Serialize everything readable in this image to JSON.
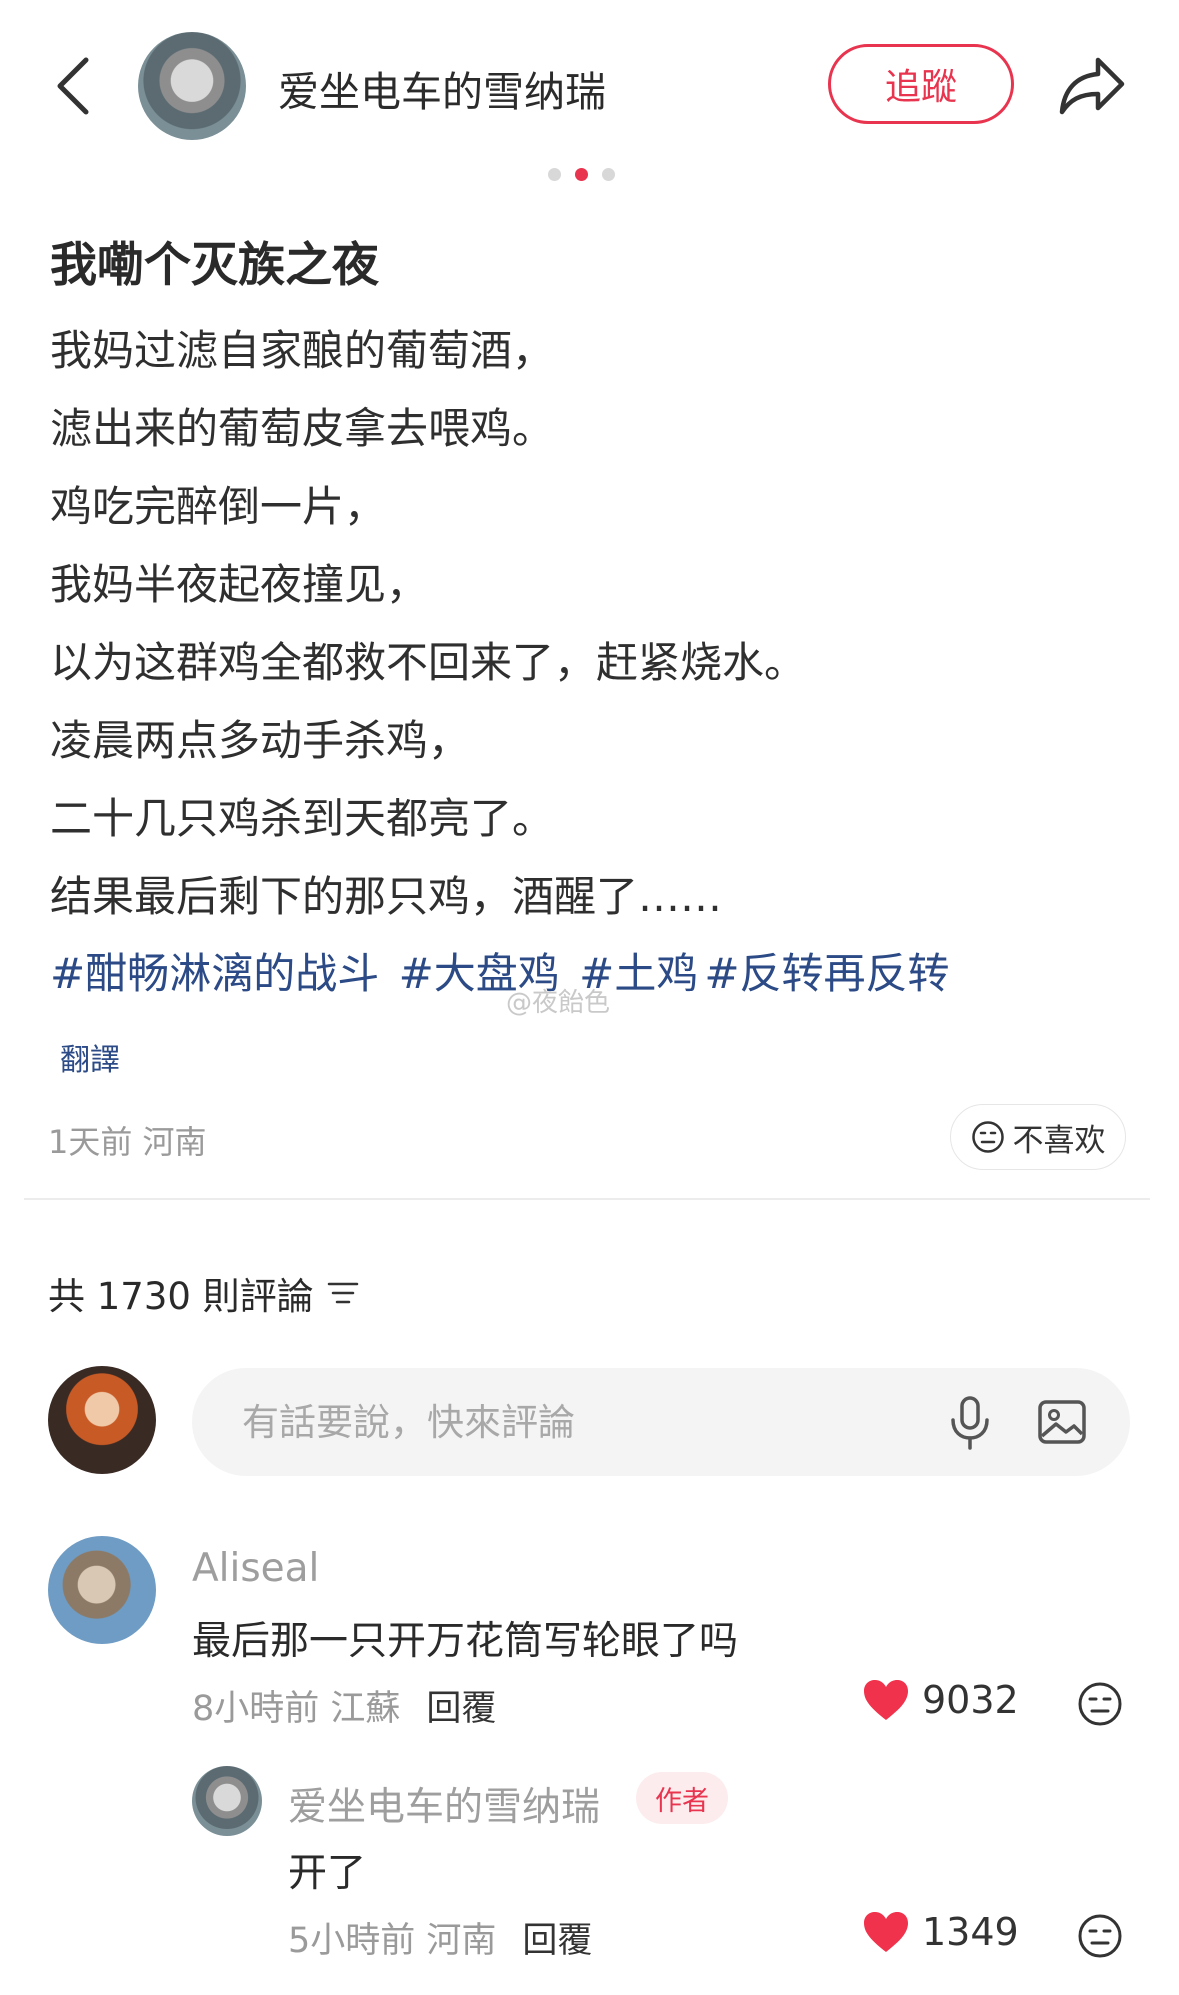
{
  "header": {
    "author": "爱坐电车的雪纳瑞",
    "follow_label": "追蹤"
  },
  "carousel": {
    "count": 3,
    "active_index": 2
  },
  "post": {
    "title": "我嘞个灭族之夜",
    "lines": [
      "我妈过滤自家酿的葡萄酒，",
      "滤出来的葡萄皮拿去喂鸡。",
      "鸡吃完醉倒一片，",
      "我妈半夜起夜撞见，",
      "以为这群鸡全都救不回来了，赶紧烧水。",
      "凌晨两点多动手杀鸡，",
      "二十几只鸡杀到天都亮了。",
      "结果最后剩下的那只鸡，酒醒了……"
    ],
    "tags": [
      "#酣畅淋漓的战斗",
      "#大盘鸡",
      "#土鸡",
      "#反转再反转"
    ],
    "watermark": "@夜飴色",
    "translate_label": "翻譯",
    "time_location": "1天前 河南",
    "dislike_label": "不喜欢"
  },
  "comments_header": {
    "label": "共 1730 則評論"
  },
  "comment_input": {
    "placeholder": "有話要說，快來評論"
  },
  "comments": [
    {
      "name": "Aliseal",
      "text": "最后那一只开万花筒写轮眼了吗",
      "time_location": "8小時前 江蘇",
      "reply_label": "回覆",
      "likes": "9032"
    },
    {
      "name": "爱坐电车的雪纳瑞",
      "badge": "作者",
      "text": "开了",
      "time_location": "5小時前 河南",
      "reply_label": "回覆",
      "likes": "1349"
    }
  ],
  "colors": {
    "accent": "#e8344e",
    "tag": "#2b4a86"
  }
}
